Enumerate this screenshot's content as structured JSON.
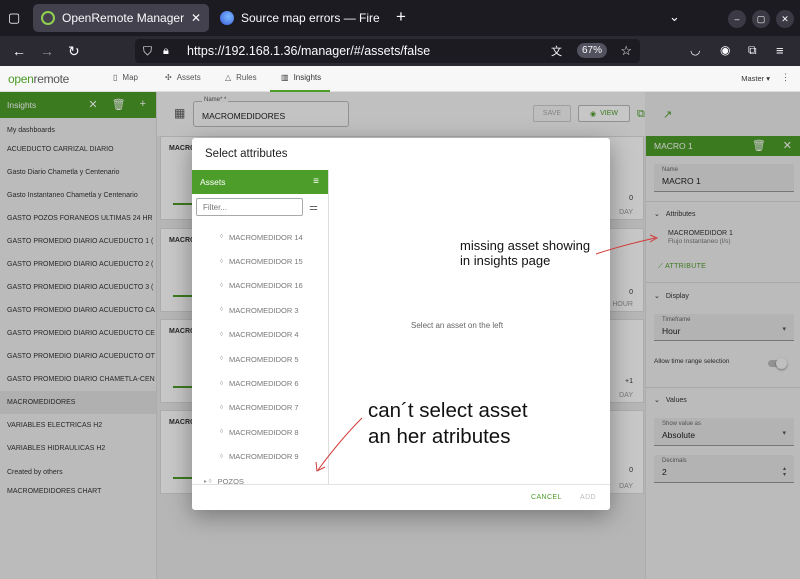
{
  "browser": {
    "tabs": [
      {
        "title": "OpenRemote Manager - ",
        "active": true
      },
      {
        "title": "Source map errors — Fire",
        "active": false
      }
    ],
    "url": "https://192.168.1.36/manager/#/assets/false",
    "zoom": "67%"
  },
  "app": {
    "logo_main": "open",
    "logo_sub": "remote",
    "nav": [
      {
        "label": "Map",
        "icon": "map-icon"
      },
      {
        "label": "Assets",
        "icon": "assets-icon"
      },
      {
        "label": "Rules",
        "icon": "rules-icon"
      },
      {
        "label": "Insights",
        "icon": "insights-icon",
        "active": true
      }
    ],
    "realm": "Master ▾"
  },
  "sidebar": {
    "title": "Insights",
    "my_dashboards_label": "My dashboards",
    "items": [
      "ACUEDUCTO CARRIZAL DIARIO",
      "Gasto Diario Chametla y Centenario",
      "Gasto Instantaneo Chametla y Centenario",
      "GASTO POZOS FORANEOS ULTIMAS 24 HR",
      "GASTO PROMEDIO DIARIO ACUEDUCTO 1 (",
      "GASTO PROMEDIO DIARIO ACUEDUCTO 2 (",
      "GASTO PROMEDIO DIARIO ACUEDUCTO 3 (",
      "GASTO PROMEDIO DIARIO ACUEDUCTO CA",
      "GASTO PROMEDIO DIARIO ACUEDUCTO CE",
      "GASTO PROMEDIO DIARIO ACUEDUCTO OT",
      "GASTO PROMEDIO DIARIO CHAMETLA-CEN",
      "MACROMEDIDORES",
      "VARIABLES ELECTRICAS H2",
      "VARIABLES HIDRAULICAS H2"
    ],
    "selected_index": 11,
    "others_label": "Created by others",
    "others_items": [
      "MACROMEDIDORES CHART"
    ]
  },
  "main": {
    "name_label": "Name* *",
    "name_value": "MACROMEDIDORES",
    "save_label": "SAVE",
    "view_label": "VIEW",
    "cards": [
      {
        "title": "MACRO",
        "r1": "0",
        "r2": "DAY"
      },
      {
        "title": "MACRO",
        "r1": "0",
        "r2": "HOUR"
      },
      {
        "title": "MACRO",
        "r1": "+1",
        "r2": "DAY"
      },
      {
        "title": "MACRO",
        "r1": "0",
        "r2": "DAY"
      }
    ]
  },
  "right_panel": {
    "title": "MACRO 1",
    "name_label": "Name",
    "name_value": "MACRO 1",
    "attributes_label": "Attributes",
    "attr_asset": "MACROMEDIDOR 1",
    "attr_name": "Flujo Instantaneo (l/s)",
    "attribute_button": "ATTRIBUTE",
    "display_label": "Display",
    "timeframe_label": "Timeframe",
    "timeframe_value": "Hour",
    "time_range_label": "Allow time range selection",
    "values_label": "Values",
    "show_value_label": "Show value as",
    "show_value_value": "Absolute",
    "decimals_label": "Decimals",
    "decimals_value": "2"
  },
  "dialog": {
    "title": "Select attributes",
    "assets_header": "Assets",
    "filter_placeholder": "Filter...",
    "assets": [
      "MACROMEDIDOR 14",
      "MACROMEDIDOR 15",
      "MACROMEDIDOR 16",
      "MACROMEDIDOR 3",
      "MACROMEDIDOR 4",
      "MACROMEDIDOR 5",
      "MACROMEDIDOR 6",
      "MACROMEDIDOR 7",
      "MACROMEDIDOR 8",
      "MACROMEDIDOR 9",
      "POZOS"
    ],
    "empty_message": "Select an asset on the left",
    "cancel_label": "CANCEL",
    "add_label": "ADD"
  },
  "annotations": {
    "note1": "missing asset showing in insights page",
    "note2": "can´t select asset an her atributes",
    "color": "#d23a3a"
  }
}
